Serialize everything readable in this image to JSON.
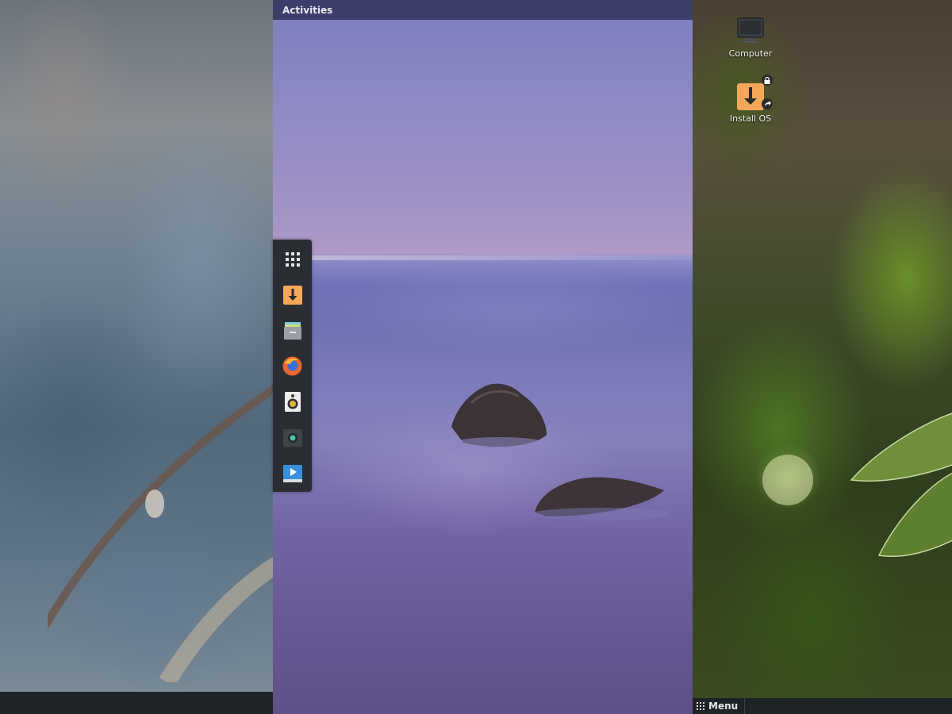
{
  "top_bar": {
    "activities_label": "Activities"
  },
  "desktop_icons": [
    {
      "label": "Computer",
      "icon": "computer-icon"
    },
    {
      "label": "Install OS",
      "icon": "install-os-icon",
      "emblems": [
        "lock-emblem-icon",
        "symlink-emblem-icon"
      ]
    }
  ],
  "dock": {
    "items": [
      {
        "name": "show-applications",
        "icon": "app-grid-icon"
      },
      {
        "name": "install-os",
        "icon": "install-os-icon"
      },
      {
        "name": "files",
        "icon": "file-manager-icon"
      },
      {
        "name": "firefox",
        "icon": "firefox-icon"
      },
      {
        "name": "rhythmbox",
        "icon": "speaker-icon"
      },
      {
        "name": "screenshot",
        "icon": "camera-icon"
      },
      {
        "name": "videos",
        "icon": "video-player-icon"
      }
    ]
  },
  "bottom_panel": {
    "menu_label": "Menu"
  },
  "colors": {
    "top_bar": "#3d3f6a",
    "dock": "#2a2e33",
    "panel": "#1e2326",
    "install_orange": "#f5a85a"
  }
}
